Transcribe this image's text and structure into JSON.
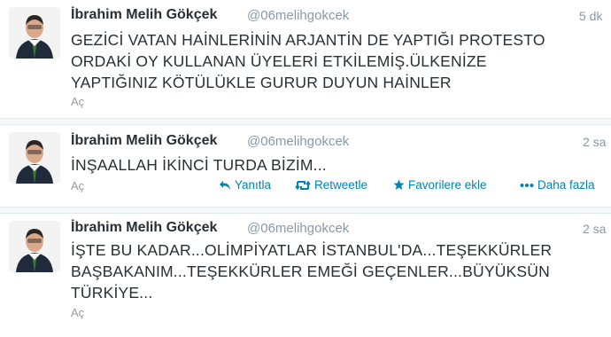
{
  "tweets": [
    {
      "name": "İbrahim Melih Gökçek",
      "handle": "@06melihgokcek",
      "time": "5 dk",
      "lines": [
        "GEZİCİ VATAN HAİNLERİNİN ARJANTİN DE YAPTIĞI PROTESTO",
        "ORDAKİ OY KULLANAN ÜYELERİ ETKİLEMİŞ.ÜLKENİZE",
        "YAPTIĞINIZ KÖTÜLÜKLE GURUR DUYUN HAİNLER"
      ],
      "expand": "Aç"
    },
    {
      "name": "İbrahim Melih Gökçek",
      "handle": "@06melihgokcek",
      "time": "2 sa",
      "lines": [
        "İNŞAALLAH İKİNCİ TURDA BİZİM..."
      ],
      "expand": "Aç",
      "actions": {
        "reply": "Yanıtla",
        "retweet": "Retweetle",
        "favorite": "Favorilere ekle",
        "more": "Daha fazla"
      }
    },
    {
      "name": "İbrahim Melih Gökçek",
      "handle": "@06melihgokcek",
      "time": "2 sa",
      "lines": [
        "İŞTE BU KADAR...OLİMPİYATLAR İSTANBUL'DA...TEŞEKKÜRLER",
        "BAŞBAKANIM...TEŞEKKÜRLER EMEĞİ GEÇENLER...BÜYÜKSÜN",
        "TÜRKİYE..."
      ],
      "expand": "Aç"
    }
  ],
  "colors": {
    "link": "#0084b4",
    "muted": "#8899a6",
    "text": "#292f33"
  },
  "icons": [
    "reply-icon",
    "retweet-icon",
    "star-icon",
    "more-dots-icon",
    "profile-avatar"
  ]
}
